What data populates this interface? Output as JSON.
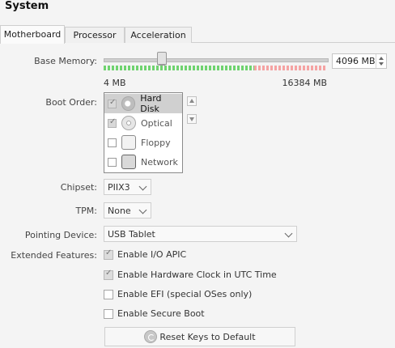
{
  "window": {
    "title": "System"
  },
  "tabs": [
    {
      "label": "Motherboard",
      "active": true
    },
    {
      "label": "Processor",
      "active": false
    },
    {
      "label": "Acceleration",
      "active": false
    }
  ],
  "memory": {
    "label": "Base Memory:",
    "value": "4096 MB",
    "min_label": "4 MB",
    "max_label": "16384 MB",
    "slider_fraction": 0.25
  },
  "boot": {
    "label": "Boot Order:",
    "items": [
      {
        "label": "Hard Disk",
        "checked": true,
        "icon": "hard-disk-icon"
      },
      {
        "label": "Optical",
        "checked": true,
        "icon": "optical-disc-icon"
      },
      {
        "label": "Floppy",
        "checked": false,
        "icon": "floppy-icon"
      },
      {
        "label": "Network",
        "checked": false,
        "icon": "network-icon"
      }
    ]
  },
  "chipset": {
    "label": "Chipset:",
    "value": "PIIX3"
  },
  "tpm": {
    "label": "TPM:",
    "value": "None"
  },
  "pointing": {
    "label": "Pointing Device:",
    "value": "USB Tablet"
  },
  "features": {
    "label": "Extended Features:",
    "items": [
      {
        "label": "Enable I/O APIC",
        "checked": true
      },
      {
        "label": "Enable Hardware Clock in UTC Time",
        "checked": true
      },
      {
        "label": "Enable EFI (special OSes only)",
        "checked": false
      },
      {
        "label": "Enable Secure Boot",
        "checked": false
      }
    ]
  },
  "reset_button": {
    "label": "Reset Keys to Default"
  },
  "colors": {
    "scale_green": "#6fd36f",
    "scale_red": "#f5a3a3",
    "selection": "#d0d0d0"
  }
}
